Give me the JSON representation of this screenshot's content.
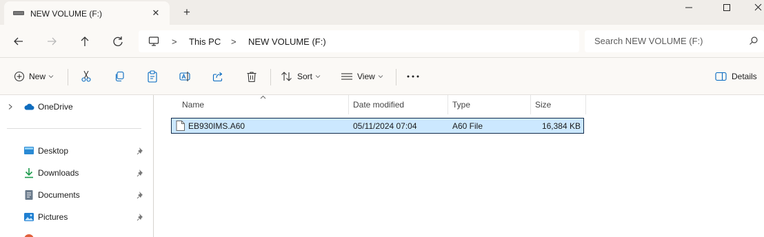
{
  "window": {
    "tab_title": "NEW VOLUME (F:)",
    "tab_close_glyph": "✕",
    "new_tab_glyph": "+"
  },
  "address": {
    "crumbs": [
      "This PC",
      "NEW VOLUME (F:)"
    ],
    "separator": ">"
  },
  "search": {
    "placeholder": "Search NEW VOLUME (F:)"
  },
  "toolbar": {
    "new_label": "New",
    "sort_label": "Sort",
    "view_label": "View",
    "details_label": "Details"
  },
  "nav": {
    "onedrive": "OneDrive",
    "items": [
      {
        "label": "Desktop",
        "icon": "desktop-icon"
      },
      {
        "label": "Downloads",
        "icon": "downloads-icon"
      },
      {
        "label": "Documents",
        "icon": "documents-icon"
      },
      {
        "label": "Pictures",
        "icon": "pictures-icon"
      }
    ]
  },
  "columns": {
    "name": "Name",
    "date": "Date modified",
    "type": "Type",
    "size": "Size"
  },
  "files": [
    {
      "name": "EB930IMS.A60",
      "date": "05/11/2024 07:04",
      "type": "A60 File",
      "size": "16,384 KB",
      "selected": true
    }
  ],
  "colors": {
    "selection_bg": "#cce8ff",
    "selection_border": "#0f2a4a",
    "accent_blue": "#0067c0",
    "chrome_bg": "#fbf9f6"
  }
}
